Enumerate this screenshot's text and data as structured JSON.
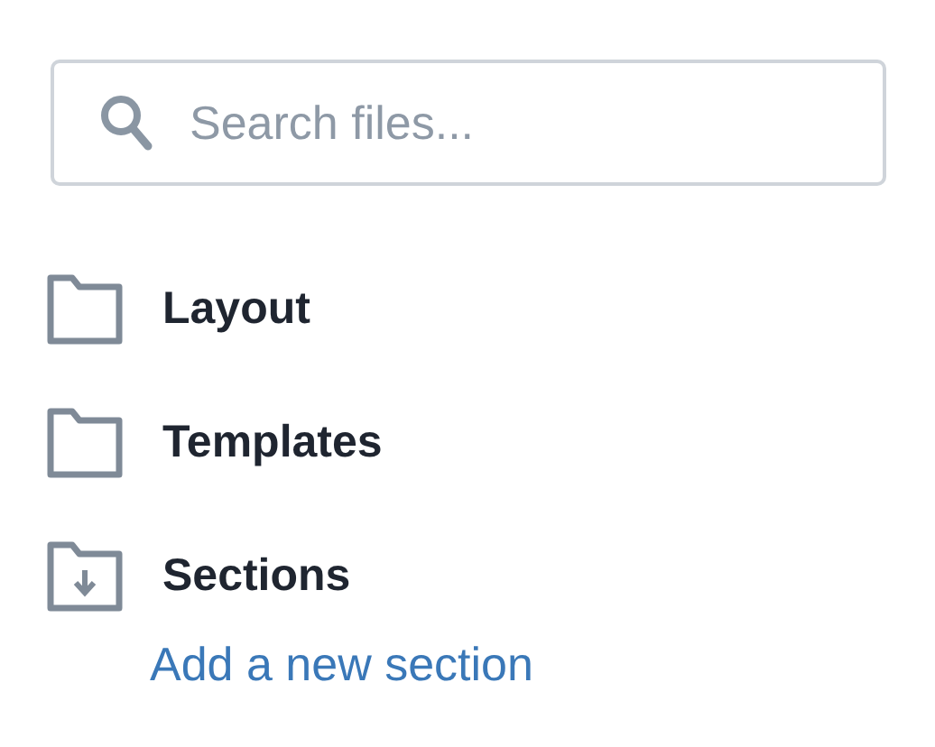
{
  "search": {
    "placeholder": "Search files..."
  },
  "folders": [
    {
      "name": "Layout",
      "expanded": false
    },
    {
      "name": "Templates",
      "expanded": false
    },
    {
      "name": "Sections",
      "expanded": true,
      "link": "Add a new section"
    }
  ]
}
